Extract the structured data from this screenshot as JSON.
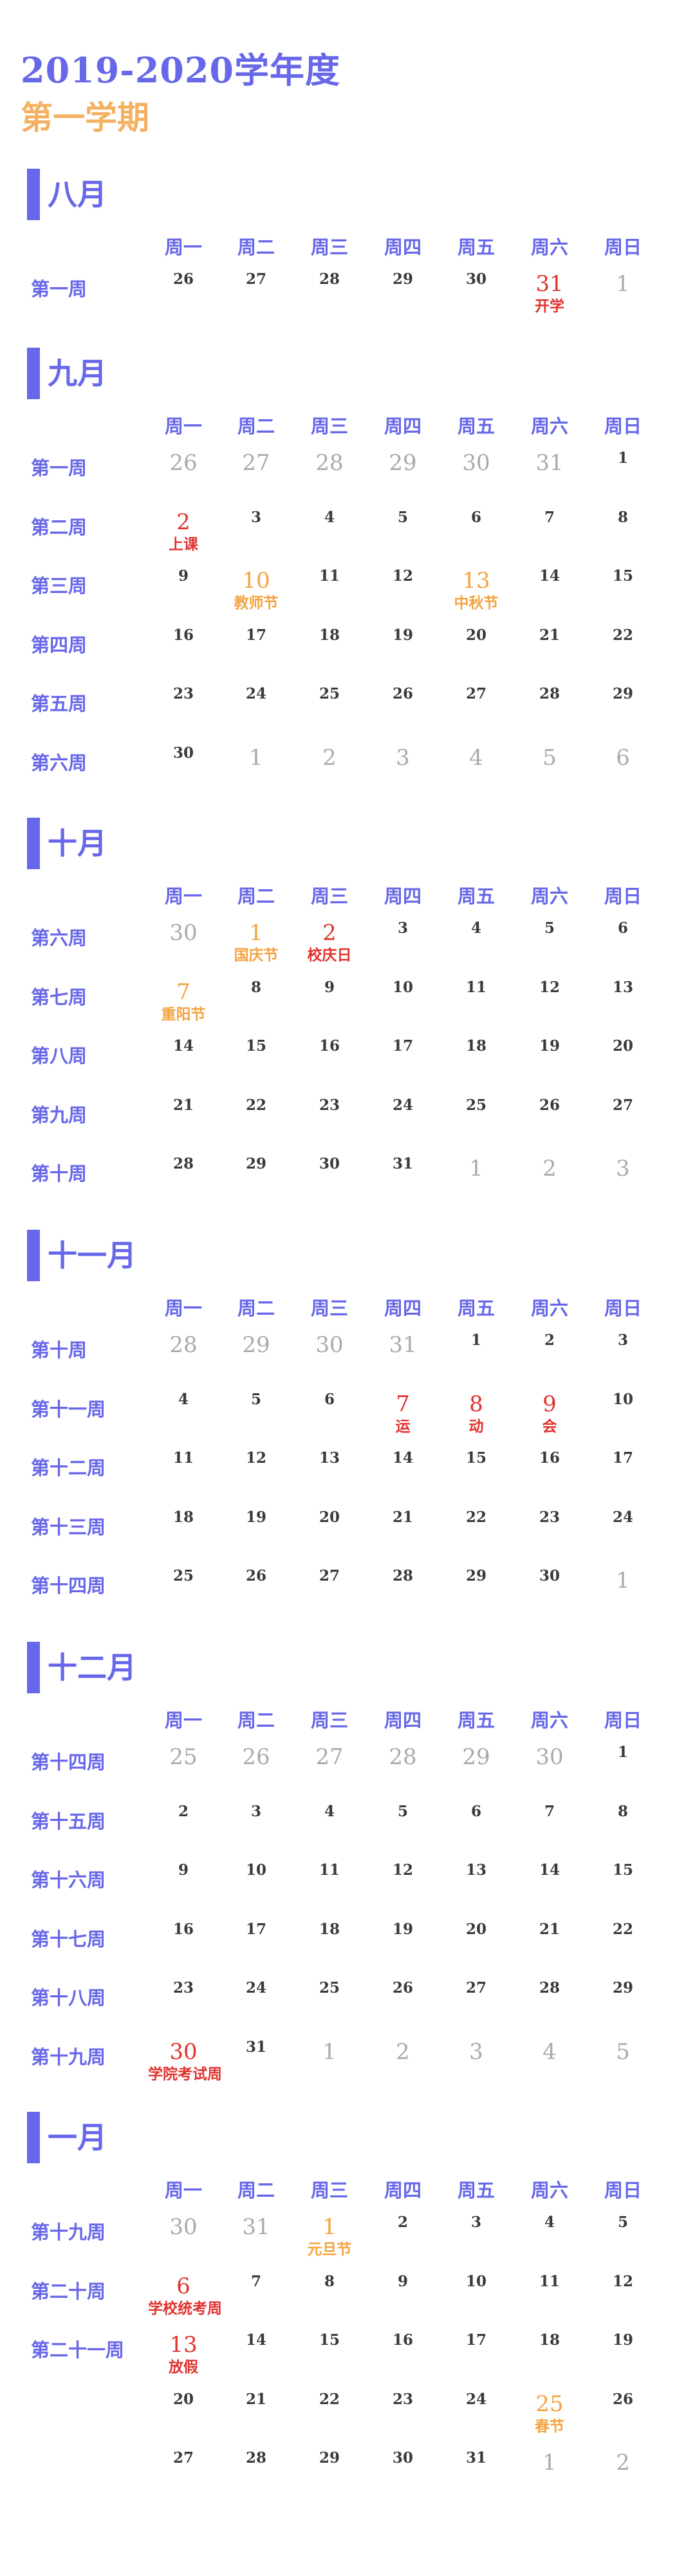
{
  "title": "2019-2020学年度",
  "subtitle": "第一学期",
  "colors": {
    "accent": "#6767ea",
    "orange": "#f4a340",
    "red": "#e0322e",
    "gray": "#aaaaaa",
    "text": "#3a3a3a"
  },
  "day_headers": [
    "周一",
    "周二",
    "周三",
    "周四",
    "周五",
    "周六",
    "周日"
  ],
  "months": [
    {
      "name": "八月",
      "weeks": [
        {
          "label": "第一周",
          "days": [
            {
              "d": "26",
              "c": "n"
            },
            {
              "d": "27",
              "c": "n"
            },
            {
              "d": "28",
              "c": "n"
            },
            {
              "d": "29",
              "c": "n"
            },
            {
              "d": "30",
              "c": "n"
            },
            {
              "d": "31",
              "c": "red",
              "note": "开学",
              "nc": "red"
            },
            {
              "d": "1",
              "c": "gray"
            }
          ]
        }
      ]
    },
    {
      "name": "九月",
      "weeks": [
        {
          "label": "第一周",
          "days": [
            {
              "d": "26",
              "c": "gray"
            },
            {
              "d": "27",
              "c": "gray"
            },
            {
              "d": "28",
              "c": "gray"
            },
            {
              "d": "29",
              "c": "gray"
            },
            {
              "d": "30",
              "c": "gray"
            },
            {
              "d": "31",
              "c": "gray"
            },
            {
              "d": "1",
              "c": "n"
            }
          ]
        },
        {
          "label": "第二周",
          "days": [
            {
              "d": "2",
              "c": "red",
              "note": "上课",
              "nc": "red"
            },
            {
              "d": "3",
              "c": "n"
            },
            {
              "d": "4",
              "c": "n"
            },
            {
              "d": "5",
              "c": "n"
            },
            {
              "d": "6",
              "c": "n"
            },
            {
              "d": "7",
              "c": "n"
            },
            {
              "d": "8",
              "c": "n"
            }
          ]
        },
        {
          "label": "第三周",
          "days": [
            {
              "d": "9",
              "c": "n"
            },
            {
              "d": "10",
              "c": "orange",
              "note": "教师节",
              "nc": "orange"
            },
            {
              "d": "11",
              "c": "n"
            },
            {
              "d": "12",
              "c": "n"
            },
            {
              "d": "13",
              "c": "orange",
              "note": "中秋节",
              "nc": "orange"
            },
            {
              "d": "14",
              "c": "n"
            },
            {
              "d": "15",
              "c": "n"
            }
          ]
        },
        {
          "label": "第四周",
          "days": [
            {
              "d": "16",
              "c": "n"
            },
            {
              "d": "17",
              "c": "n"
            },
            {
              "d": "18",
              "c": "n"
            },
            {
              "d": "19",
              "c": "n"
            },
            {
              "d": "20",
              "c": "n"
            },
            {
              "d": "21",
              "c": "n"
            },
            {
              "d": "22",
              "c": "n"
            }
          ]
        },
        {
          "label": "第五周",
          "days": [
            {
              "d": "23",
              "c": "n"
            },
            {
              "d": "24",
              "c": "n"
            },
            {
              "d": "25",
              "c": "n"
            },
            {
              "d": "26",
              "c": "n"
            },
            {
              "d": "27",
              "c": "n"
            },
            {
              "d": "28",
              "c": "n"
            },
            {
              "d": "29",
              "c": "n"
            }
          ]
        },
        {
          "label": "第六周",
          "days": [
            {
              "d": "30",
              "c": "n"
            },
            {
              "d": "1",
              "c": "gray"
            },
            {
              "d": "2",
              "c": "gray"
            },
            {
              "d": "3",
              "c": "gray"
            },
            {
              "d": "4",
              "c": "gray"
            },
            {
              "d": "5",
              "c": "gray"
            },
            {
              "d": "6",
              "c": "gray"
            }
          ]
        }
      ]
    },
    {
      "name": "十月",
      "weeks": [
        {
          "label": "第六周",
          "days": [
            {
              "d": "30",
              "c": "gray"
            },
            {
              "d": "1",
              "c": "orange",
              "note": "国庆节",
              "nc": "orange"
            },
            {
              "d": "2",
              "c": "red",
              "note": "校庆日",
              "nc": "red"
            },
            {
              "d": "3",
              "c": "n"
            },
            {
              "d": "4",
              "c": "n"
            },
            {
              "d": "5",
              "c": "n"
            },
            {
              "d": "6",
              "c": "n"
            }
          ]
        },
        {
          "label": "第七周",
          "days": [
            {
              "d": "7",
              "c": "orange",
              "note": "重阳节",
              "nc": "orange"
            },
            {
              "d": "8",
              "c": "n"
            },
            {
              "d": "9",
              "c": "n"
            },
            {
              "d": "10",
              "c": "n"
            },
            {
              "d": "11",
              "c": "n"
            },
            {
              "d": "12",
              "c": "n"
            },
            {
              "d": "13",
              "c": "n"
            }
          ]
        },
        {
          "label": "第八周",
          "days": [
            {
              "d": "14",
              "c": "n"
            },
            {
              "d": "15",
              "c": "n"
            },
            {
              "d": "16",
              "c": "n"
            },
            {
              "d": "17",
              "c": "n"
            },
            {
              "d": "18",
              "c": "n"
            },
            {
              "d": "19",
              "c": "n"
            },
            {
              "d": "20",
              "c": "n"
            }
          ]
        },
        {
          "label": "第九周",
          "days": [
            {
              "d": "21",
              "c": "n"
            },
            {
              "d": "22",
              "c": "n"
            },
            {
              "d": "23",
              "c": "n"
            },
            {
              "d": "24",
              "c": "n"
            },
            {
              "d": "25",
              "c": "n"
            },
            {
              "d": "26",
              "c": "n"
            },
            {
              "d": "27",
              "c": "n"
            }
          ]
        },
        {
          "label": "第十周",
          "days": [
            {
              "d": "28",
              "c": "n"
            },
            {
              "d": "29",
              "c": "n"
            },
            {
              "d": "30",
              "c": "n"
            },
            {
              "d": "31",
              "c": "n"
            },
            {
              "d": "1",
              "c": "gray"
            },
            {
              "d": "2",
              "c": "gray"
            },
            {
              "d": "3",
              "c": "gray"
            }
          ]
        }
      ]
    },
    {
      "name": "十一月",
      "weeks": [
        {
          "label": "第十周",
          "days": [
            {
              "d": "28",
              "c": "gray"
            },
            {
              "d": "29",
              "c": "gray"
            },
            {
              "d": "30",
              "c": "gray"
            },
            {
              "d": "31",
              "c": "gray"
            },
            {
              "d": "1",
              "c": "n"
            },
            {
              "d": "2",
              "c": "n"
            },
            {
              "d": "3",
              "c": "n"
            }
          ]
        },
        {
          "label": "第十一周",
          "days": [
            {
              "d": "4",
              "c": "n"
            },
            {
              "d": "5",
              "c": "n"
            },
            {
              "d": "6",
              "c": "n"
            },
            {
              "d": "7",
              "c": "red",
              "note": "运",
              "nc": "red"
            },
            {
              "d": "8",
              "c": "red",
              "note": "动",
              "nc": "red"
            },
            {
              "d": "9",
              "c": "red",
              "note": "会",
              "nc": "red"
            },
            {
              "d": "10",
              "c": "n"
            }
          ]
        },
        {
          "label": "第十二周",
          "days": [
            {
              "d": "11",
              "c": "n"
            },
            {
              "d": "12",
              "c": "n"
            },
            {
              "d": "13",
              "c": "n"
            },
            {
              "d": "14",
              "c": "n"
            },
            {
              "d": "15",
              "c": "n"
            },
            {
              "d": "16",
              "c": "n"
            },
            {
              "d": "17",
              "c": "n"
            }
          ]
        },
        {
          "label": "第十三周",
          "days": [
            {
              "d": "18",
              "c": "n"
            },
            {
              "d": "19",
              "c": "n"
            },
            {
              "d": "20",
              "c": "n"
            },
            {
              "d": "21",
              "c": "n"
            },
            {
              "d": "22",
              "c": "n"
            },
            {
              "d": "23",
              "c": "n"
            },
            {
              "d": "24",
              "c": "n"
            }
          ]
        },
        {
          "label": "第十四周",
          "days": [
            {
              "d": "25",
              "c": "n"
            },
            {
              "d": "26",
              "c": "n"
            },
            {
              "d": "27",
              "c": "n"
            },
            {
              "d": "28",
              "c": "n"
            },
            {
              "d": "29",
              "c": "n"
            },
            {
              "d": "30",
              "c": "n"
            },
            {
              "d": "1",
              "c": "gray"
            }
          ]
        }
      ]
    },
    {
      "name": "十二月",
      "weeks": [
        {
          "label": "第十四周",
          "days": [
            {
              "d": "25",
              "c": "gray"
            },
            {
              "d": "26",
              "c": "gray"
            },
            {
              "d": "27",
              "c": "gray"
            },
            {
              "d": "28",
              "c": "gray"
            },
            {
              "d": "29",
              "c": "gray"
            },
            {
              "d": "30",
              "c": "gray"
            },
            {
              "d": "1",
              "c": "n"
            }
          ]
        },
        {
          "label": "第十五周",
          "days": [
            {
              "d": "2",
              "c": "n"
            },
            {
              "d": "3",
              "c": "n"
            },
            {
              "d": "4",
              "c": "n"
            },
            {
              "d": "5",
              "c": "n"
            },
            {
              "d": "6",
              "c": "n"
            },
            {
              "d": "7",
              "c": "n"
            },
            {
              "d": "8",
              "c": "n"
            }
          ]
        },
        {
          "label": "第十六周",
          "days": [
            {
              "d": "9",
              "c": "n"
            },
            {
              "d": "10",
              "c": "n"
            },
            {
              "d": "11",
              "c": "n"
            },
            {
              "d": "12",
              "c": "n"
            },
            {
              "d": "13",
              "c": "n"
            },
            {
              "d": "14",
              "c": "n"
            },
            {
              "d": "15",
              "c": "n"
            }
          ]
        },
        {
          "label": "第十七周",
          "days": [
            {
              "d": "16",
              "c": "n"
            },
            {
              "d": "17",
              "c": "n"
            },
            {
              "d": "18",
              "c": "n"
            },
            {
              "d": "19",
              "c": "n"
            },
            {
              "d": "20",
              "c": "n"
            },
            {
              "d": "21",
              "c": "n"
            },
            {
              "d": "22",
              "c": "n"
            }
          ]
        },
        {
          "label": "第十八周",
          "days": [
            {
              "d": "23",
              "c": "n"
            },
            {
              "d": "24",
              "c": "n"
            },
            {
              "d": "25",
              "c": "n"
            },
            {
              "d": "26",
              "c": "n"
            },
            {
              "d": "27",
              "c": "n"
            },
            {
              "d": "28",
              "c": "n"
            },
            {
              "d": "29",
              "c": "n"
            }
          ]
        },
        {
          "label": "第十九周",
          "days": [
            {
              "d": "30",
              "c": "red",
              "note": "学院考试周",
              "nc": "red"
            },
            {
              "d": "31",
              "c": "n"
            },
            {
              "d": "1",
              "c": "gray"
            },
            {
              "d": "2",
              "c": "gray"
            },
            {
              "d": "3",
              "c": "gray"
            },
            {
              "d": "4",
              "c": "gray"
            },
            {
              "d": "5",
              "c": "gray"
            }
          ]
        }
      ]
    },
    {
      "name": "一月",
      "weeks": [
        {
          "label": "第十九周",
          "days": [
            {
              "d": "30",
              "c": "gray"
            },
            {
              "d": "31",
              "c": "gray"
            },
            {
              "d": "1",
              "c": "orange",
              "note": "元旦节",
              "nc": "orange"
            },
            {
              "d": "2",
              "c": "n"
            },
            {
              "d": "3",
              "c": "n"
            },
            {
              "d": "4",
              "c": "n"
            },
            {
              "d": "5",
              "c": "n"
            }
          ]
        },
        {
          "label": "第二十周",
          "days": [
            {
              "d": "6",
              "c": "red",
              "note": "学校统考周",
              "nc": "red"
            },
            {
              "d": "7",
              "c": "n"
            },
            {
              "d": "8",
              "c": "n"
            },
            {
              "d": "9",
              "c": "n"
            },
            {
              "d": "10",
              "c": "n"
            },
            {
              "d": "11",
              "c": "n"
            },
            {
              "d": "12",
              "c": "n"
            }
          ]
        },
        {
          "label": "第二十一周",
          "days": [
            {
              "d": "13",
              "c": "red",
              "note": "放假",
              "nc": "red"
            },
            {
              "d": "14",
              "c": "n"
            },
            {
              "d": "15",
              "c": "n"
            },
            {
              "d": "16",
              "c": "n"
            },
            {
              "d": "17",
              "c": "n"
            },
            {
              "d": "18",
              "c": "n"
            },
            {
              "d": "19",
              "c": "n"
            }
          ]
        },
        {
          "label": "",
          "days": [
            {
              "d": "20",
              "c": "n"
            },
            {
              "d": "21",
              "c": "n"
            },
            {
              "d": "22",
              "c": "n"
            },
            {
              "d": "23",
              "c": "n"
            },
            {
              "d": "24",
              "c": "n"
            },
            {
              "d": "25",
              "c": "orange",
              "note": "春节",
              "nc": "orange"
            },
            {
              "d": "26",
              "c": "n"
            }
          ]
        },
        {
          "label": "",
          "days": [
            {
              "d": "27",
              "c": "n"
            },
            {
              "d": "28",
              "c": "n"
            },
            {
              "d": "29",
              "c": "n"
            },
            {
              "d": "30",
              "c": "n"
            },
            {
              "d": "31",
              "c": "n"
            },
            {
              "d": "1",
              "c": "gray"
            },
            {
              "d": "2",
              "c": "gray"
            }
          ]
        }
      ]
    }
  ]
}
